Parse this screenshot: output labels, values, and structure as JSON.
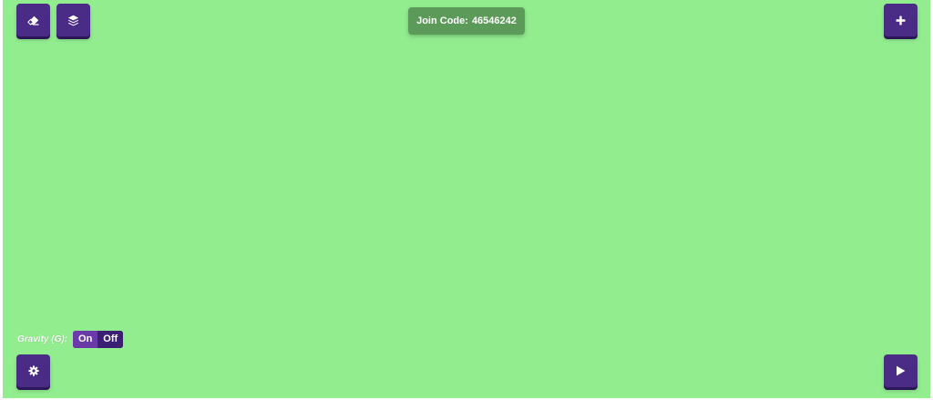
{
  "toolbar": {
    "eraser_icon": "eraser-icon",
    "layers_icon": "layers-icon",
    "add_icon": "plus-icon",
    "settings_icon": "gear-icon",
    "play_icon": "play-icon"
  },
  "join_code": {
    "label": "Join Code:",
    "value": "46546242"
  },
  "gravity": {
    "label": "Gravity (G):",
    "on_label": "On",
    "off_label": "Off",
    "selected": "On"
  },
  "colors": {
    "canvas_background": "#92ed8f",
    "button_purple": "#4a2b86",
    "join_code_background": "#5b9a58"
  }
}
